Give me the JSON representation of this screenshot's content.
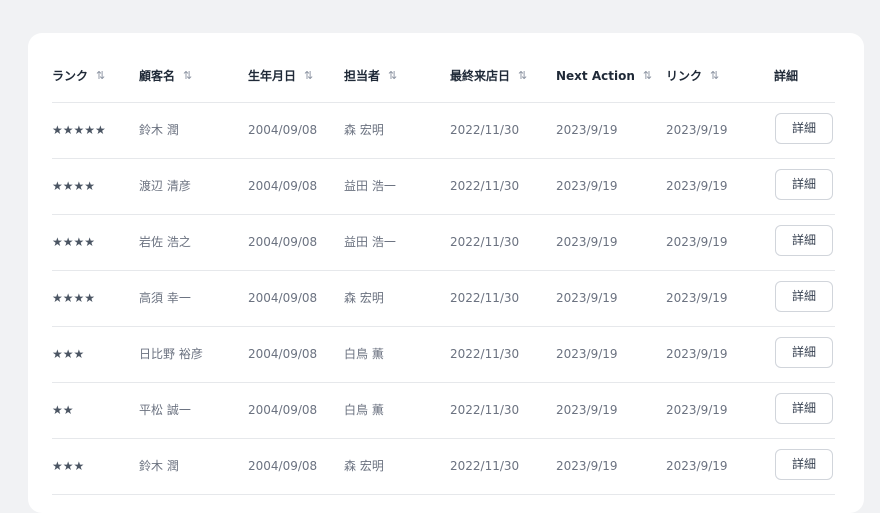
{
  "table": {
    "headers": {
      "rank": "ランク",
      "customer": "顧客名",
      "birthdate": "生年月日",
      "staff": "担当者",
      "last_visit": "最終来店日",
      "next_action": "Next Action",
      "link": "リンク",
      "detail": "詳細"
    },
    "sort_icon": "⇅",
    "rows": [
      {
        "rank": "★★★★★",
        "customer": "鈴木 潤",
        "birthdate": "2004/09/08",
        "staff": "森 宏明",
        "last_visit": "2022/11/30",
        "next_action": "2023/9/19",
        "link": "2023/9/19",
        "detail": "詳細"
      },
      {
        "rank": "★★★★",
        "customer": "渡辺 清彦",
        "birthdate": "2004/09/08",
        "staff": "益田 浩一",
        "last_visit": "2022/11/30",
        "next_action": "2023/9/19",
        "link": "2023/9/19",
        "detail": "詳細"
      },
      {
        "rank": "★★★★",
        "customer": "岩佐 浩之",
        "birthdate": "2004/09/08",
        "staff": "益田 浩一",
        "last_visit": "2022/11/30",
        "next_action": "2023/9/19",
        "link": "2023/9/19",
        "detail": "詳細"
      },
      {
        "rank": "★★★★",
        "customer": "高須 幸一",
        "birthdate": "2004/09/08",
        "staff": "森 宏明",
        "last_visit": "2022/11/30",
        "next_action": "2023/9/19",
        "link": "2023/9/19",
        "detail": "詳細"
      },
      {
        "rank": "★★★",
        "customer": "日比野 裕彦",
        "birthdate": "2004/09/08",
        "staff": "白鳥 薫",
        "last_visit": "2022/11/30",
        "next_action": "2023/9/19",
        "link": "2023/9/19",
        "detail": "詳細"
      },
      {
        "rank": "★★",
        "customer": "平松 誠一",
        "birthdate": "2004/09/08",
        "staff": "白鳥 薫",
        "last_visit": "2022/11/30",
        "next_action": "2023/9/19",
        "link": "2023/9/19",
        "detail": "詳細"
      },
      {
        "rank": "★★★",
        "customer": "鈴木 潤",
        "birthdate": "2004/09/08",
        "staff": "森 宏明",
        "last_visit": "2022/11/30",
        "next_action": "2023/9/19",
        "link": "2023/9/19",
        "detail": "詳細"
      }
    ]
  }
}
